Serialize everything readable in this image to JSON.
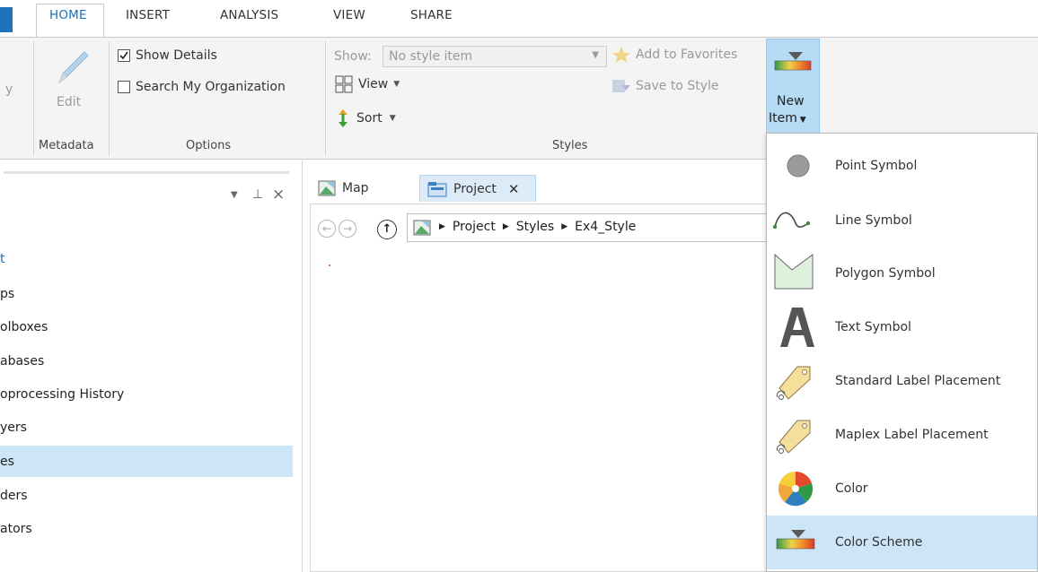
{
  "ribbon_tabs": [
    "HOME",
    "INSERT",
    "ANALYSIS",
    "VIEW",
    "SHARE"
  ],
  "ribbon": {
    "partial_left_label": "y",
    "edit_label": "Edit",
    "metadata_group": "Metadata",
    "show_details": "Show Details",
    "search_org": "Search My Organization",
    "options_group": "Options",
    "show_label": "Show:",
    "show_value": "No style item",
    "view_label": "View",
    "sort_label": "Sort",
    "add_favorites": "Add to Favorites",
    "save_to_style": "Save to Style",
    "styles_group": "Styles",
    "new_item_line1": "New",
    "new_item_line2": "Item"
  },
  "pane": {
    "items": [
      "t",
      "ps",
      "olboxes",
      "abases",
      "oprocessing History",
      "yers",
      "es",
      "ders",
      "ators"
    ],
    "selected_index": 6
  },
  "doc_tabs": {
    "map": "Map",
    "project": "Project"
  },
  "breadcrumb": [
    "Project",
    "Styles",
    "Ex4_Style"
  ],
  "new_item_menu": {
    "items": [
      "Point Symbol",
      "Line Symbol",
      "Polygon Symbol",
      "Text Symbol",
      "Standard Label Placement",
      "Maplex Label Placement",
      "Color",
      "Color Scheme"
    ],
    "highlighted_index": 7
  },
  "colors": {
    "accent": "#1a6fc0",
    "selection": "#cde6f7",
    "ribbon_bg": "#f4f4f4"
  }
}
